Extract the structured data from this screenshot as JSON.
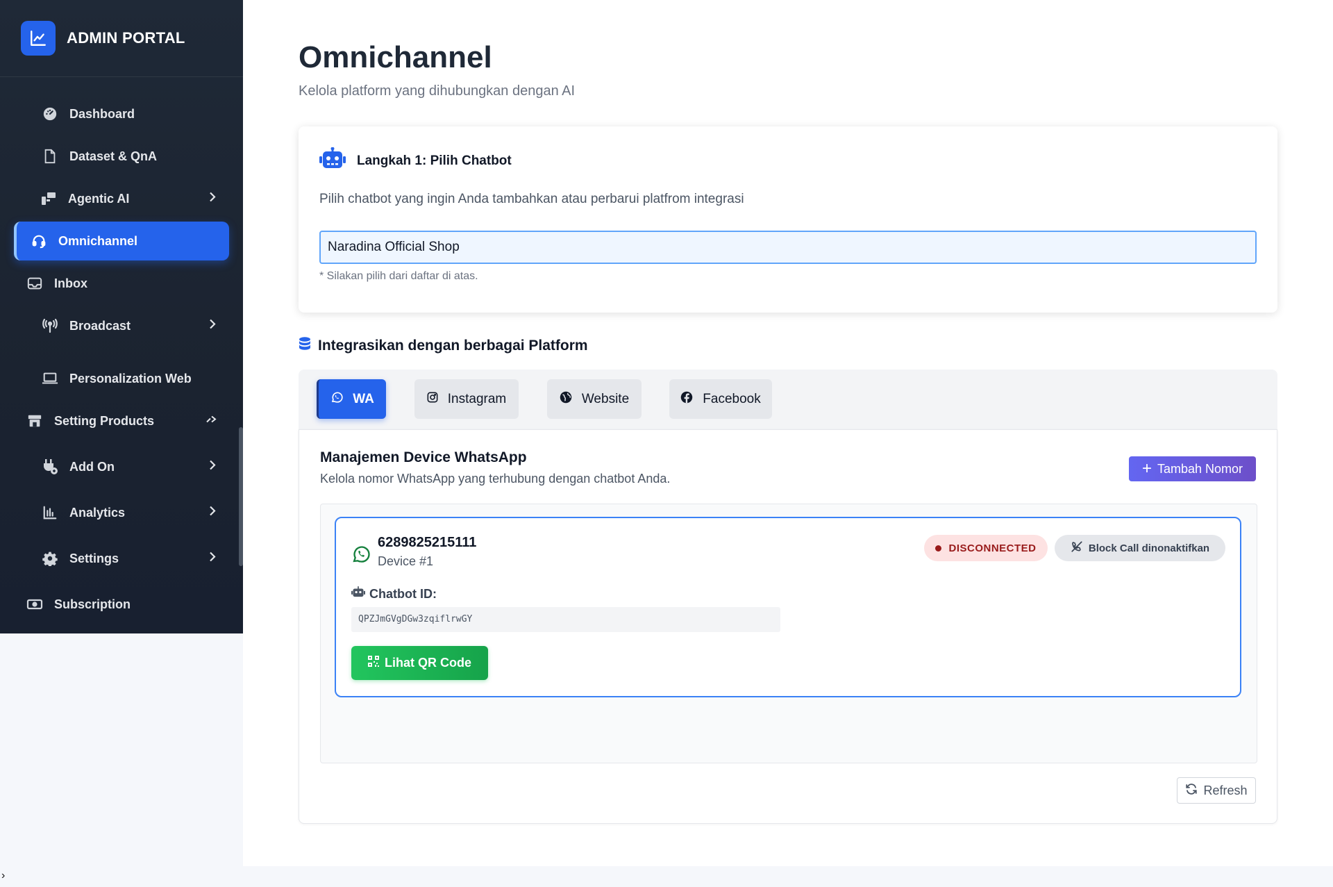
{
  "sidebar": {
    "brand": "ADMIN PORTAL",
    "items": [
      {
        "label": "Dashboard"
      },
      {
        "label": "Dataset & QnA"
      },
      {
        "label": "Agentic AI"
      },
      {
        "label": "Omnichannel"
      },
      {
        "label": "Inbox"
      },
      {
        "label": "Broadcast"
      },
      {
        "label": "Personalization Web"
      },
      {
        "label": "Setting Products"
      },
      {
        "label": "Add On"
      },
      {
        "label": "Analytics"
      },
      {
        "label": "Settings"
      },
      {
        "label": "Subscription"
      }
    ],
    "active": "Omnichannel"
  },
  "page": {
    "title": "Omnichannel",
    "subtitle": "Kelola platform yang dihubungkan dengan AI"
  },
  "step1": {
    "title": "Langkah 1: Pilih Chatbot",
    "description": "Pilih chatbot yang ingin Anda tambahkan atau perbarui platfrom integrasi",
    "selected": "Naradina Official Shop",
    "hint": "* Silakan pilih dari daftar di atas."
  },
  "integration": {
    "title": "Integrasikan dengan berbagai Platform",
    "tabs": [
      {
        "label": "WA",
        "icon": "whatsapp-icon"
      },
      {
        "label": "Instagram",
        "icon": "instagram-icon"
      },
      {
        "label": "Website",
        "icon": "globe-icon"
      },
      {
        "label": "Facebook",
        "icon": "facebook-icon"
      }
    ],
    "active_tab": "WA"
  },
  "whatsapp": {
    "title": "Manajemen Device WhatsApp",
    "subtitle": "Kelola nomor WhatsApp yang terhubung dengan chatbot Anda.",
    "add_label": "Tambah Nomor",
    "device": {
      "number": "6289825215111",
      "name": "Device #1",
      "status": "DISCONNECTED",
      "block_call": "Block Call dinonaktifkan",
      "chatbot_id_label": "Chatbot ID:",
      "chatbot_id": "QPZJmGVgDGw3zqiflrwGY",
      "qr_label": "Lihat QR Code"
    },
    "refresh_label": "Refresh"
  },
  "colors": {
    "accent": "#2563eb",
    "sidebar_bg": "#1f2937",
    "status_disconnected": "#991b1b",
    "qr_button": "#22c55e"
  }
}
